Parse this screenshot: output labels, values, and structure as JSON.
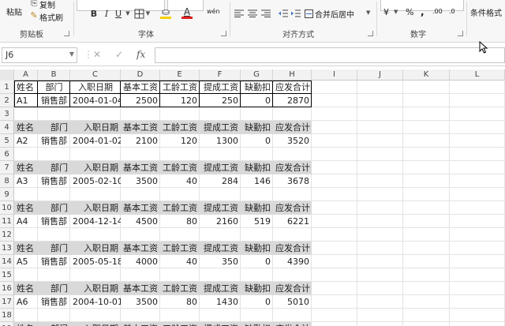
{
  "ribbon": {
    "clipboard": {
      "paste": "粘贴",
      "copy": "复制",
      "format_painter": "格式刷",
      "group": "剪贴板"
    },
    "font": {
      "bold": "B",
      "italic": "I",
      "underline": "U",
      "borders_icon": "borders-icon",
      "fill_icon": "fill-color-icon",
      "font_color": "A",
      "font_color_hex": "#e02020",
      "fill_hex": "#f5d000",
      "phonetic": "wén",
      "group": "字体"
    },
    "alignment": {
      "merge_center": "合并后居中",
      "group": "对齐方式"
    },
    "number": {
      "currency": "¥",
      "percent": "%",
      "comma": ",",
      "inc_decimal": ".00",
      "dec_decimal": ".0",
      "group": "数字"
    },
    "styles": {
      "conditional_format": "条件格式"
    }
  },
  "formula_bar": {
    "name_box": "J6",
    "cancel": "✕",
    "enter": "✓",
    "fx": "fx",
    "value": ""
  },
  "grid": {
    "columns": [
      "A",
      "B",
      "C",
      "D",
      "E",
      "F",
      "G",
      "H",
      "I",
      "J",
      "K",
      "L"
    ],
    "rows": [
      "1",
      "2",
      "3",
      "4",
      "5",
      "6",
      "7",
      "8",
      "9",
      "10",
      "11",
      "12",
      "13",
      "14",
      "15",
      "16",
      "17",
      "18"
    ],
    "headers": [
      "姓名",
      "部门",
      "入职日期",
      "基本工资",
      "工龄工资",
      "提成工资",
      "缺勤扣",
      "应发合计"
    ],
    "records": [
      [
        "A1",
        "销售部",
        "2004-01-04",
        "2500",
        "120",
        "250",
        "0",
        "2870"
      ],
      [
        "A2",
        "销售部",
        "2004-01-02",
        "2100",
        "120",
        "1300",
        "0",
        "3520"
      ],
      [
        "A3",
        "销售部",
        "2005-02-10",
        "3500",
        "40",
        "284",
        "146",
        "3678"
      ],
      [
        "A4",
        "销售部",
        "2004-12-14",
        "4500",
        "80",
        "2160",
        "519",
        "6221"
      ],
      [
        "A5",
        "销售部",
        "2005-05-18",
        "4000",
        "40",
        "350",
        "0",
        "4390"
      ],
      [
        "A6",
        "销售部",
        "2004-10-01",
        "3500",
        "80",
        "1430",
        "0",
        "5010"
      ]
    ]
  }
}
